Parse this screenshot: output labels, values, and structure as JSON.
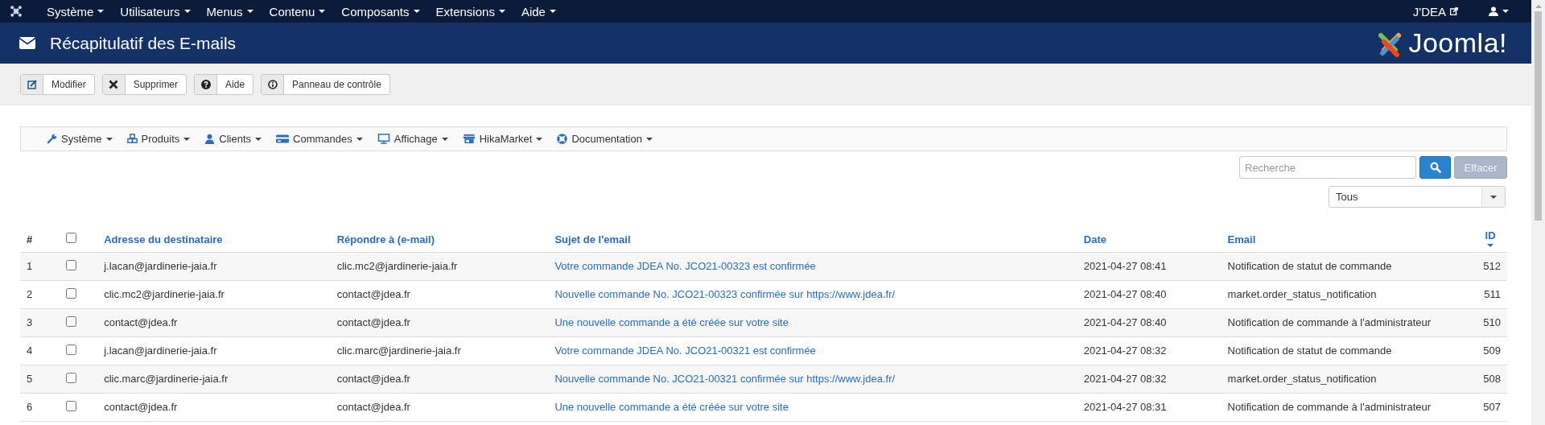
{
  "topnav": {
    "menus": [
      "Système",
      "Utilisateurs",
      "Menus",
      "Contenu",
      "Composants",
      "Extensions",
      "Aide"
    ],
    "site_link": "J'DEA"
  },
  "header": {
    "title": "Récapitulatif des E-mails",
    "logo_text": "Joomla!"
  },
  "toolbar": [
    {
      "label": "Modifier",
      "kind": "edit"
    },
    {
      "label": "Supprimer",
      "kind": "delete"
    },
    {
      "label": "Aide",
      "kind": "help"
    },
    {
      "label": "Panneau de contrôle",
      "kind": "dashboard"
    }
  ],
  "submenu": [
    {
      "label": "Système",
      "kind": "wrench"
    },
    {
      "label": "Produits",
      "kind": "cubes"
    },
    {
      "label": "Clients",
      "kind": "user"
    },
    {
      "label": "Commandes",
      "kind": "card"
    },
    {
      "label": "Affichage",
      "kind": "monitor"
    },
    {
      "label": "HikaMarket",
      "kind": "store"
    },
    {
      "label": "Documentation",
      "kind": "lifebuoy"
    }
  ],
  "search": {
    "placeholder": "Recherche",
    "clear": "Effacer"
  },
  "filter": {
    "value": "Tous"
  },
  "table": {
    "select_all_checked": false,
    "columns": [
      "#",
      "Adresse du destinataire",
      "Répondre à (e-mail)",
      "Sujet de l'email",
      "Date",
      "Email",
      "ID"
    ],
    "rows": [
      {
        "num": "1",
        "checked": false,
        "recipient": "j.lacan@jardinerie-jaia.fr",
        "reply_to": "clic.mc2@jardinerie-jaia.fr",
        "subject": "Votre commande JDEA No. JCO21-00323 est confirmée",
        "date": "2021-04-27 08:41",
        "email": "Notification de statut de commande",
        "id": "512"
      },
      {
        "num": "2",
        "checked": false,
        "recipient": "clic.mc2@jardinerie-jaia.fr",
        "reply_to": "contact@jdea.fr",
        "subject": "Nouvelle commande No. JCO21-00323 confirmée sur https://www.jdea.fr/",
        "date": "2021-04-27 08:40",
        "email": "market.order_status_notification",
        "id": "511"
      },
      {
        "num": "3",
        "checked": false,
        "recipient": "contact@jdea.fr",
        "reply_to": "contact@jdea.fr",
        "subject": "Une nouvelle commande a été créée sur votre site",
        "date": "2021-04-27 08:40",
        "email": "Notification de commande à l'administrateur",
        "id": "510"
      },
      {
        "num": "4",
        "checked": false,
        "recipient": "j.lacan@jardinerie-jaia.fr",
        "reply_to": "clic.marc@jardinerie-jaia.fr",
        "subject": "Votre commande JDEA No. JCO21-00321 est confirmée",
        "date": "2021-04-27 08:32",
        "email": "Notification de statut de commande",
        "id": "509"
      },
      {
        "num": "5",
        "checked": false,
        "recipient": "clic.marc@jardinerie-jaia.fr",
        "reply_to": "contact@jdea.fr",
        "subject": "Nouvelle commande No. JCO21-00321 confirmée sur https://www.jdea.fr/",
        "date": "2021-04-27 08:32",
        "email": "market.order_status_notification",
        "id": "508"
      },
      {
        "num": "6",
        "checked": false,
        "recipient": "contact@jdea.fr",
        "reply_to": "contact@jdea.fr",
        "subject": "Une nouvelle commande a été créée sur votre site",
        "date": "2021-04-27 08:31",
        "email": "Notification de commande à l'administrateur",
        "id": "507"
      }
    ]
  }
}
